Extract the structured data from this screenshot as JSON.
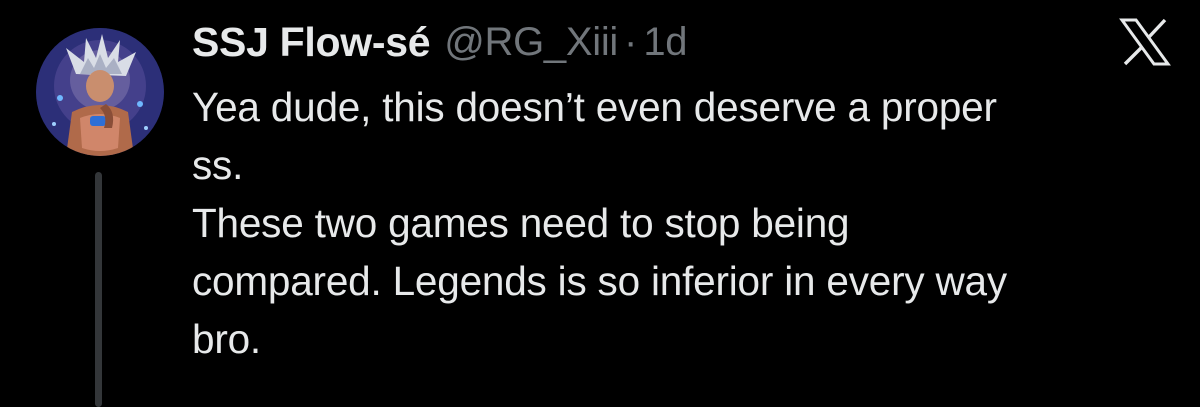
{
  "tweet": {
    "author": {
      "display_name": "SSJ Flow-sé",
      "handle": "@RG_Xiii",
      "avatar_icon": "avatar-anime-character-icon"
    },
    "separator": "·",
    "time": "1d",
    "brand_icon": "x-logo-icon",
    "text_lines": [
      "Yea dude, this doesn’t even deserve a proper",
      "ss.",
      "These two games need to stop being",
      "compared. Legends is so inferior in every way",
      "bro."
    ]
  },
  "colors": {
    "background": "#000000",
    "primary_text": "#e7e9ea",
    "secondary_text": "#71767b",
    "thread_line": "#333639"
  }
}
